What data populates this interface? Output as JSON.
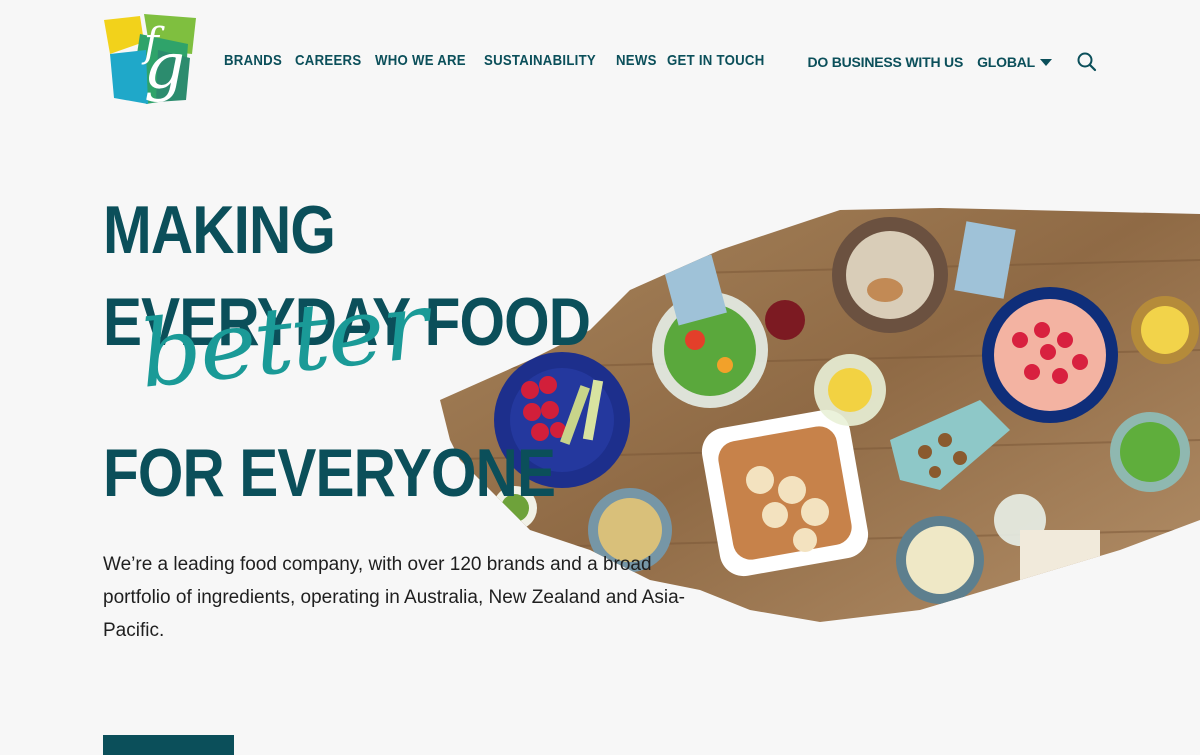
{
  "nav": {
    "items": [
      "BRANDS",
      "CAREERS",
      "WHO WE ARE",
      "SUSTAINABILITY",
      "NEWS",
      "GET IN TOUCH"
    ]
  },
  "utility": {
    "do_business": "DO BUSINESS WITH US",
    "region": "GLOBAL"
  },
  "hero": {
    "headline_line1": "MAKING",
    "headline_line2": "EVERYDAY FOOD",
    "headline_script": "better",
    "headline_line3": "FOR EVERYONE",
    "lede": "We’re a leading food company, with over 120 brands and a broad portfolio of ingredients, operating in Australia, New Zealand and Asia-Pacific."
  },
  "colors": {
    "primary": "#0b4f5a",
    "accent": "#1a9a97",
    "background": "#f7f7f7"
  }
}
